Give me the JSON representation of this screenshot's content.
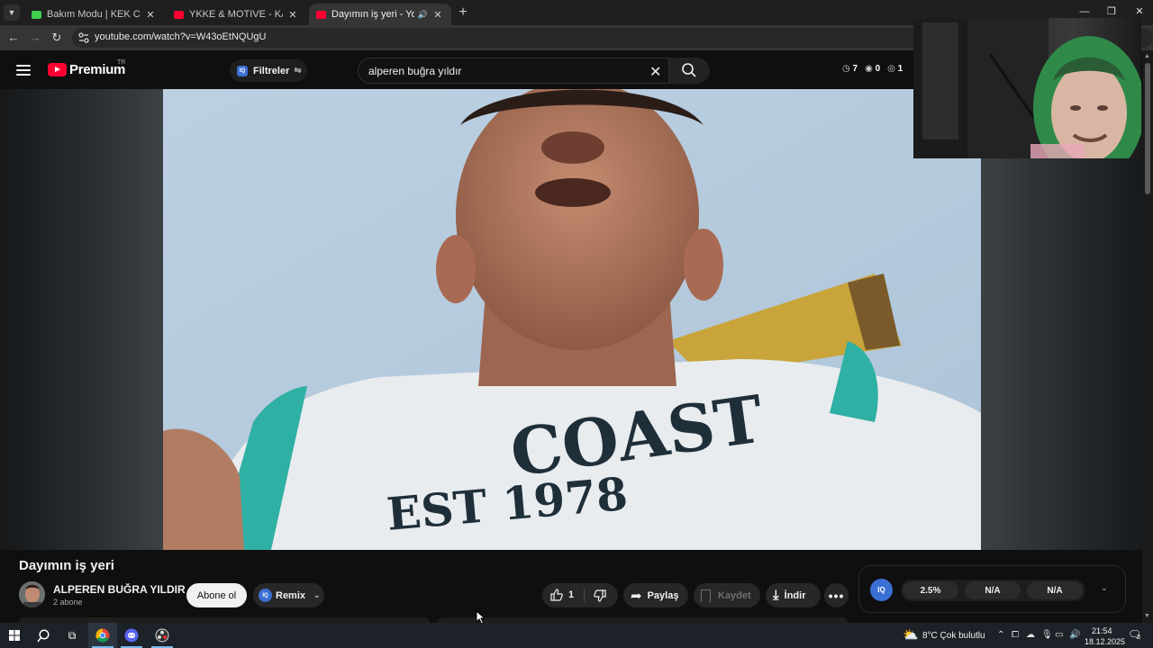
{
  "browser": {
    "tabs": [
      {
        "title": "Bakım Modu | KEK Community",
        "favicon_color": "#3ecf4f",
        "active": false
      },
      {
        "title": "YKKE & MOTIVE - KARANLIK (O",
        "favicon_color": "#ff0033",
        "active": false
      },
      {
        "title": "Dayımın iş yeri - YouTube",
        "favicon_color": "#ff0033",
        "active": true,
        "audio": true
      }
    ],
    "new_tab_glyph": "+",
    "url": "youtube.com/watch?v=W43oEtNQUgU"
  },
  "youtube": {
    "logo_text": "Premium",
    "country": "TR",
    "filters_label": "Filtreler",
    "search_query": "alperen buğra yıldır",
    "stats": {
      "watch": "7",
      "views": "0",
      "count": "1"
    }
  },
  "video": {
    "title": "Dayımın iş yeri",
    "shirt_text_1": "COAST",
    "shirt_text_2": "EST 1978"
  },
  "channel": {
    "name": "ALPEREN BUĞRA YILDIR",
    "subscribers": "2 abone",
    "subscribe_label": "Abone ol",
    "remix_label": "Remix"
  },
  "actions": {
    "likes": "1",
    "share_label": "Paylaş",
    "save_label": "Kaydet",
    "download_label": "İndir"
  },
  "iq_panel": {
    "badge": "IQ",
    "values": [
      "2.5%",
      "N/A",
      "N/A"
    ]
  },
  "taskbar": {
    "weather": "8°C  Çok bulutlu",
    "time": "21:54",
    "date": "18.12.2025",
    "notifications": "3"
  },
  "colors": {
    "accent_blue": "#3b6fd4",
    "youtube_red": "#ff0033"
  }
}
